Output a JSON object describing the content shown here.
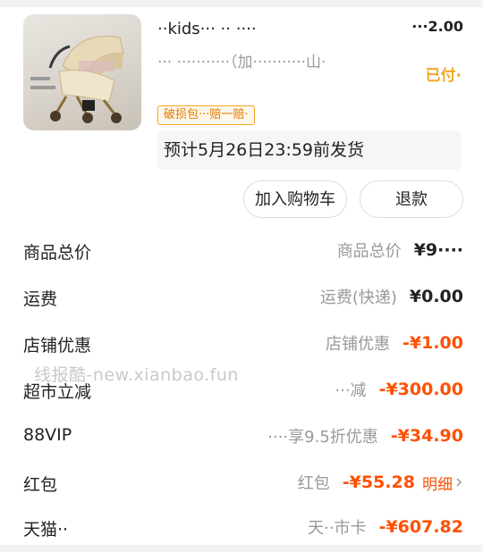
{
  "product": {
    "title": "··kids··· ·· ····",
    "price": "···2.00",
    "sku": "··· ···········（加···········山·",
    "status": "已付·",
    "tag": "破损包···赔一赔·",
    "ship_note": "预计5月26日23:59前发货"
  },
  "buttons": {
    "add_cart": "加入购物车",
    "refund": "退款"
  },
  "rows": [
    {
      "label": "商品总价",
      "desc": "商品总价",
      "amount": "¥9····",
      "negative": false,
      "detail": ""
    },
    {
      "label": "运费",
      "desc": "运费(快递)",
      "amount": "¥0.00",
      "negative": false,
      "detail": ""
    },
    {
      "label": "店铺优惠",
      "desc": "店铺优惠",
      "amount": "-¥1.00",
      "negative": true,
      "detail": ""
    },
    {
      "label": "超市立减",
      "desc": "···减",
      "amount": "-¥300.00",
      "negative": true,
      "detail": ""
    },
    {
      "label": "88VIP",
      "desc": "····享9.5折优惠",
      "amount": "-¥34.90",
      "negative": true,
      "detail": ""
    },
    {
      "label": "红包",
      "desc": "红包",
      "amount": "-¥55.28",
      "negative": true,
      "detail": "明细"
    },
    {
      "label": "天猫··",
      "desc": "天··市卡",
      "amount": "-¥607.82",
      "negative": true,
      "detail": ""
    }
  ],
  "watermark": "线报酷-new.xianbao.fun",
  "colors": {
    "accent": "#ff5000",
    "paid": "#f5a623",
    "muted": "#999999"
  }
}
